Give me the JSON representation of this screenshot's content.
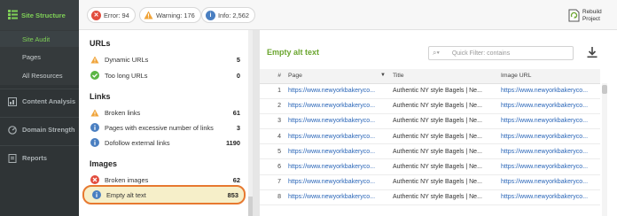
{
  "sidebar": {
    "header": "Site Structure",
    "sub_items": [
      {
        "label": "Site Audit",
        "active": true
      },
      {
        "label": "Pages",
        "active": false
      },
      {
        "label": "All Resources",
        "active": false
      }
    ],
    "items": [
      {
        "label": "Content Analysis",
        "icon": "content-icon"
      },
      {
        "label": "Domain Strength",
        "icon": "gauge-icon"
      },
      {
        "label": "Reports",
        "icon": "report-icon"
      }
    ]
  },
  "topbar": {
    "error": "Error: 94",
    "warning": "Warning: 176",
    "info": "Info: 2,562",
    "rebuild_line1": "Rebuild",
    "rebuild_line2": "Project"
  },
  "middle": {
    "sections": [
      {
        "title": "URLs",
        "rows": [
          {
            "label": "Dynamic URLs",
            "count": "5",
            "status": "warning"
          },
          {
            "label": "Too long URLs",
            "count": "0",
            "status": "ok"
          }
        ]
      },
      {
        "title": "Links",
        "rows": [
          {
            "label": "Broken links",
            "count": "61",
            "status": "warning"
          },
          {
            "label": "Pages with excessive number of links",
            "count": "3",
            "status": "info"
          },
          {
            "label": "Dofollow external links",
            "count": "1190",
            "status": "info"
          }
        ]
      },
      {
        "title": "Images",
        "rows": [
          {
            "label": "Broken images",
            "count": "62",
            "status": "error"
          },
          {
            "label": "Empty alt text",
            "count": "853",
            "status": "info",
            "selected": true
          }
        ]
      }
    ]
  },
  "right": {
    "title": "Empty alt text",
    "filter_placeholder": "Quick Filter: contains",
    "columns": [
      "#",
      "Page",
      "Title",
      "Image URL"
    ],
    "rows": [
      {
        "n": "1",
        "page": "https://www.newyorkbakeryco...",
        "title": "Authentic NY style Bagels | Ne...",
        "image": "https://www.newyorkbakeryco..."
      },
      {
        "n": "2",
        "page": "https://www.newyorkbakeryco...",
        "title": "Authentic NY style Bagels | Ne...",
        "image": "https://www.newyorkbakeryco..."
      },
      {
        "n": "3",
        "page": "https://www.newyorkbakeryco...",
        "title": "Authentic NY style Bagels | Ne...",
        "image": "https://www.newyorkbakeryco..."
      },
      {
        "n": "4",
        "page": "https://www.newyorkbakeryco...",
        "title": "Authentic NY style Bagels | Ne...",
        "image": "https://www.newyorkbakeryco..."
      },
      {
        "n": "5",
        "page": "https://www.newyorkbakeryco...",
        "title": "Authentic NY style Bagels | Ne...",
        "image": "https://www.newyorkbakeryco..."
      },
      {
        "n": "6",
        "page": "https://www.newyorkbakeryco...",
        "title": "Authentic NY style Bagels | Ne...",
        "image": "https://www.newyorkbakeryco..."
      },
      {
        "n": "7",
        "page": "https://www.newyorkbakeryco...",
        "title": "Authentic NY style Bagels | Ne...",
        "image": "https://www.newyorkbakeryco..."
      },
      {
        "n": "8",
        "page": "https://www.newyorkbakeryco...",
        "title": "Authentic NY style Bagels | Ne...",
        "image": "https://www.newyorkbakeryco..."
      }
    ]
  },
  "colors": {
    "accent_green": "#7fd057",
    "title_green": "#6aa52e",
    "error_red": "#e24c3d",
    "warning_orange": "#f0a43a",
    "info_blue": "#4a7fc1",
    "ok_green": "#5bb544",
    "selection_outline": "#e77930"
  }
}
